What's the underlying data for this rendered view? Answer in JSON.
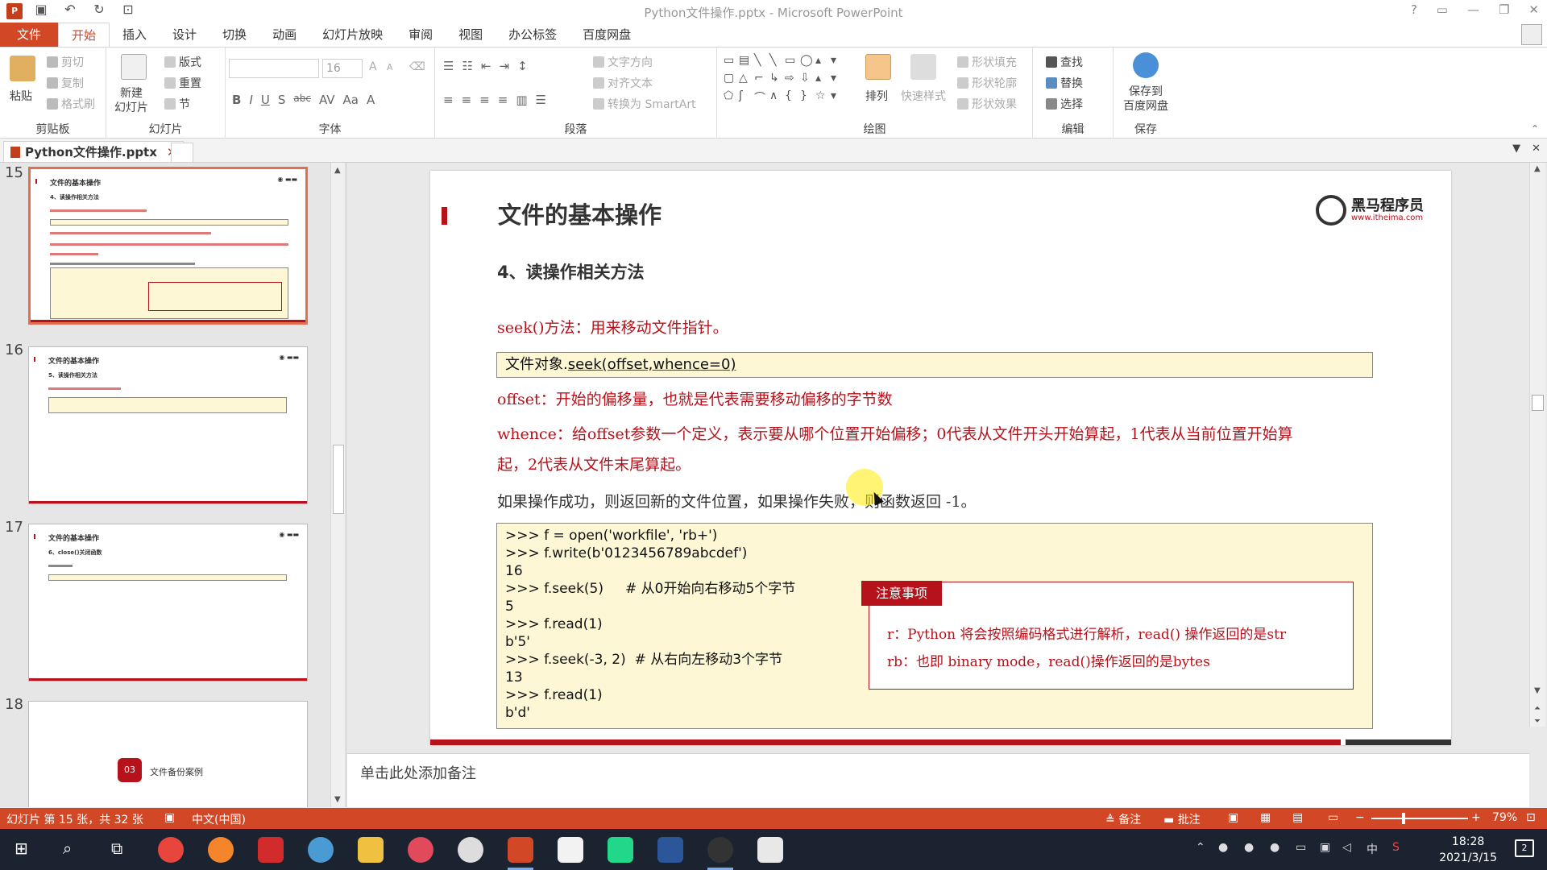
{
  "window": {
    "app_icon": "P",
    "title": "Python文件操作.pptx - Microsoft PowerPoint",
    "controls": [
      "?",
      "▭",
      "—",
      "❐",
      "✕"
    ]
  },
  "quick_access": [
    "save-icon",
    "undo-icon",
    "redo-icon",
    "slideshow-icon"
  ],
  "ribbon_tabs": [
    "文件",
    "开始",
    "插入",
    "设计",
    "切换",
    "动画",
    "幻灯片放映",
    "审阅",
    "视图",
    "办公标签",
    "百度网盘"
  ],
  "ribbon": {
    "clipboard": {
      "label": "剪贴板",
      "paste": "粘贴",
      "cut": "剪切",
      "copy": "复制",
      "format_painter": "格式刷"
    },
    "slides": {
      "label": "幻灯片",
      "new_slide": "新建\n幻灯片",
      "layout": "版式",
      "reset": "重置",
      "section": "节"
    },
    "font": {
      "label": "字体",
      "font_size": "16",
      "format_buttons": [
        "B",
        "I",
        "U",
        "S",
        "abc",
        "AV",
        "Aa",
        "A"
      ],
      "grow": "A",
      "shrink": "A"
    },
    "paragraph": {
      "label": "段落",
      "text_direction": "文字方向",
      "align_text": "对齐文本",
      "smartart": "转换为 SmartArt"
    },
    "drawing": {
      "label": "绘图",
      "arrange": "排列",
      "quick_styles": "快速样式",
      "shape_fill": "形状填充",
      "shape_outline": "形状轮廓",
      "shape_effects": "形状效果",
      "shapes": [
        "▭",
        "▤",
        "╲",
        "╲",
        "▭",
        "◯",
        "▴",
        "▾",
        "▢",
        "△",
        "⌐",
        "↳",
        "⇨",
        "⇩",
        "▴",
        "▾",
        "⬠",
        "ʃ",
        "⌒",
        "∧",
        "{",
        "}",
        "☆",
        "▾"
      ]
    },
    "editing": {
      "label": "编辑",
      "find": "查找",
      "replace": "替换",
      "select": "选择"
    },
    "save": {
      "label": "保存",
      "save_to_baidu": "保存到\n百度网盘"
    }
  },
  "document_tab": {
    "name": "Python文件操作.pptx",
    "close": "✕"
  },
  "thumbnails": [
    {
      "number": "15",
      "title": "文件的基本操作",
      "sub": "4、读操作相关方法",
      "selected": true
    },
    {
      "number": "16",
      "title": "文件的基本操作",
      "sub": "5、读操作相关方法",
      "selected": false
    },
    {
      "number": "17",
      "title": "文件的基本操作",
      "sub": "6、close()关闭函数",
      "selected": false
    },
    {
      "number": "18",
      "section_number": "03",
      "section_title": "文件备份案例",
      "selected": false
    }
  ],
  "slide": {
    "title": "文件的基本操作",
    "logo_name": "黑马程序员",
    "logo_url": "www.itheima.com",
    "subtitle": "4、读操作相关方法",
    "seek_desc": "seek()方法：用来移动文件指针。",
    "syntax_prefix": "文件对象.",
    "syntax_call": "seek(offset,whence=0)",
    "offset_desc": "offset：开始的偏移量，也就是代表需要移动偏移的字节数",
    "whence_desc_1": "whence：给offset参数一个定义，表示要从哪个位置开始偏移；0代表从文件开头开始算起，1代表从当前位置开始算",
    "whence_desc_2": "起，2代表从文件末尾算起。",
    "return_desc": "如果操作成功，则返回新的文件位置，如果操作失败，则函数返回 -1。",
    "code_lines": [
      ">>> f = open('workfile', 'rb+')",
      ">>> f.write(b'0123456789abcdef')",
      "16",
      ">>> f.seek(5)     # 从0开始向右移动5个字节",
      "5",
      ">>> f.read(1)",
      "b'5'",
      ">>> f.seek(-3, 2)  # 从右向左移动3个字节",
      "13",
      ">>> f.read(1)",
      "b'd'"
    ],
    "note_title": "注意事项",
    "note_line_1": "r：Python 将会按照编码格式进行解析，read() 操作返回的是str",
    "note_line_2": "rb：也即 binary mode，read()操作返回的是bytes"
  },
  "notes_placeholder": "单击此处添加备注",
  "status": {
    "slide_info": "幻灯片 第 15 张，共 32 张",
    "language": "中文(中国)",
    "notes_btn": "备注",
    "comments_btn": "批注",
    "zoom_minus": "−",
    "zoom_plus": "+",
    "zoom": "79%"
  },
  "taskbar": {
    "time": "18:28",
    "date": "2021/3/15",
    "ime": "中",
    "notification_count": "2"
  },
  "colors": {
    "accent": "#d24726",
    "slide_red": "#b5121b",
    "code_bg": "#fdf7d6"
  }
}
